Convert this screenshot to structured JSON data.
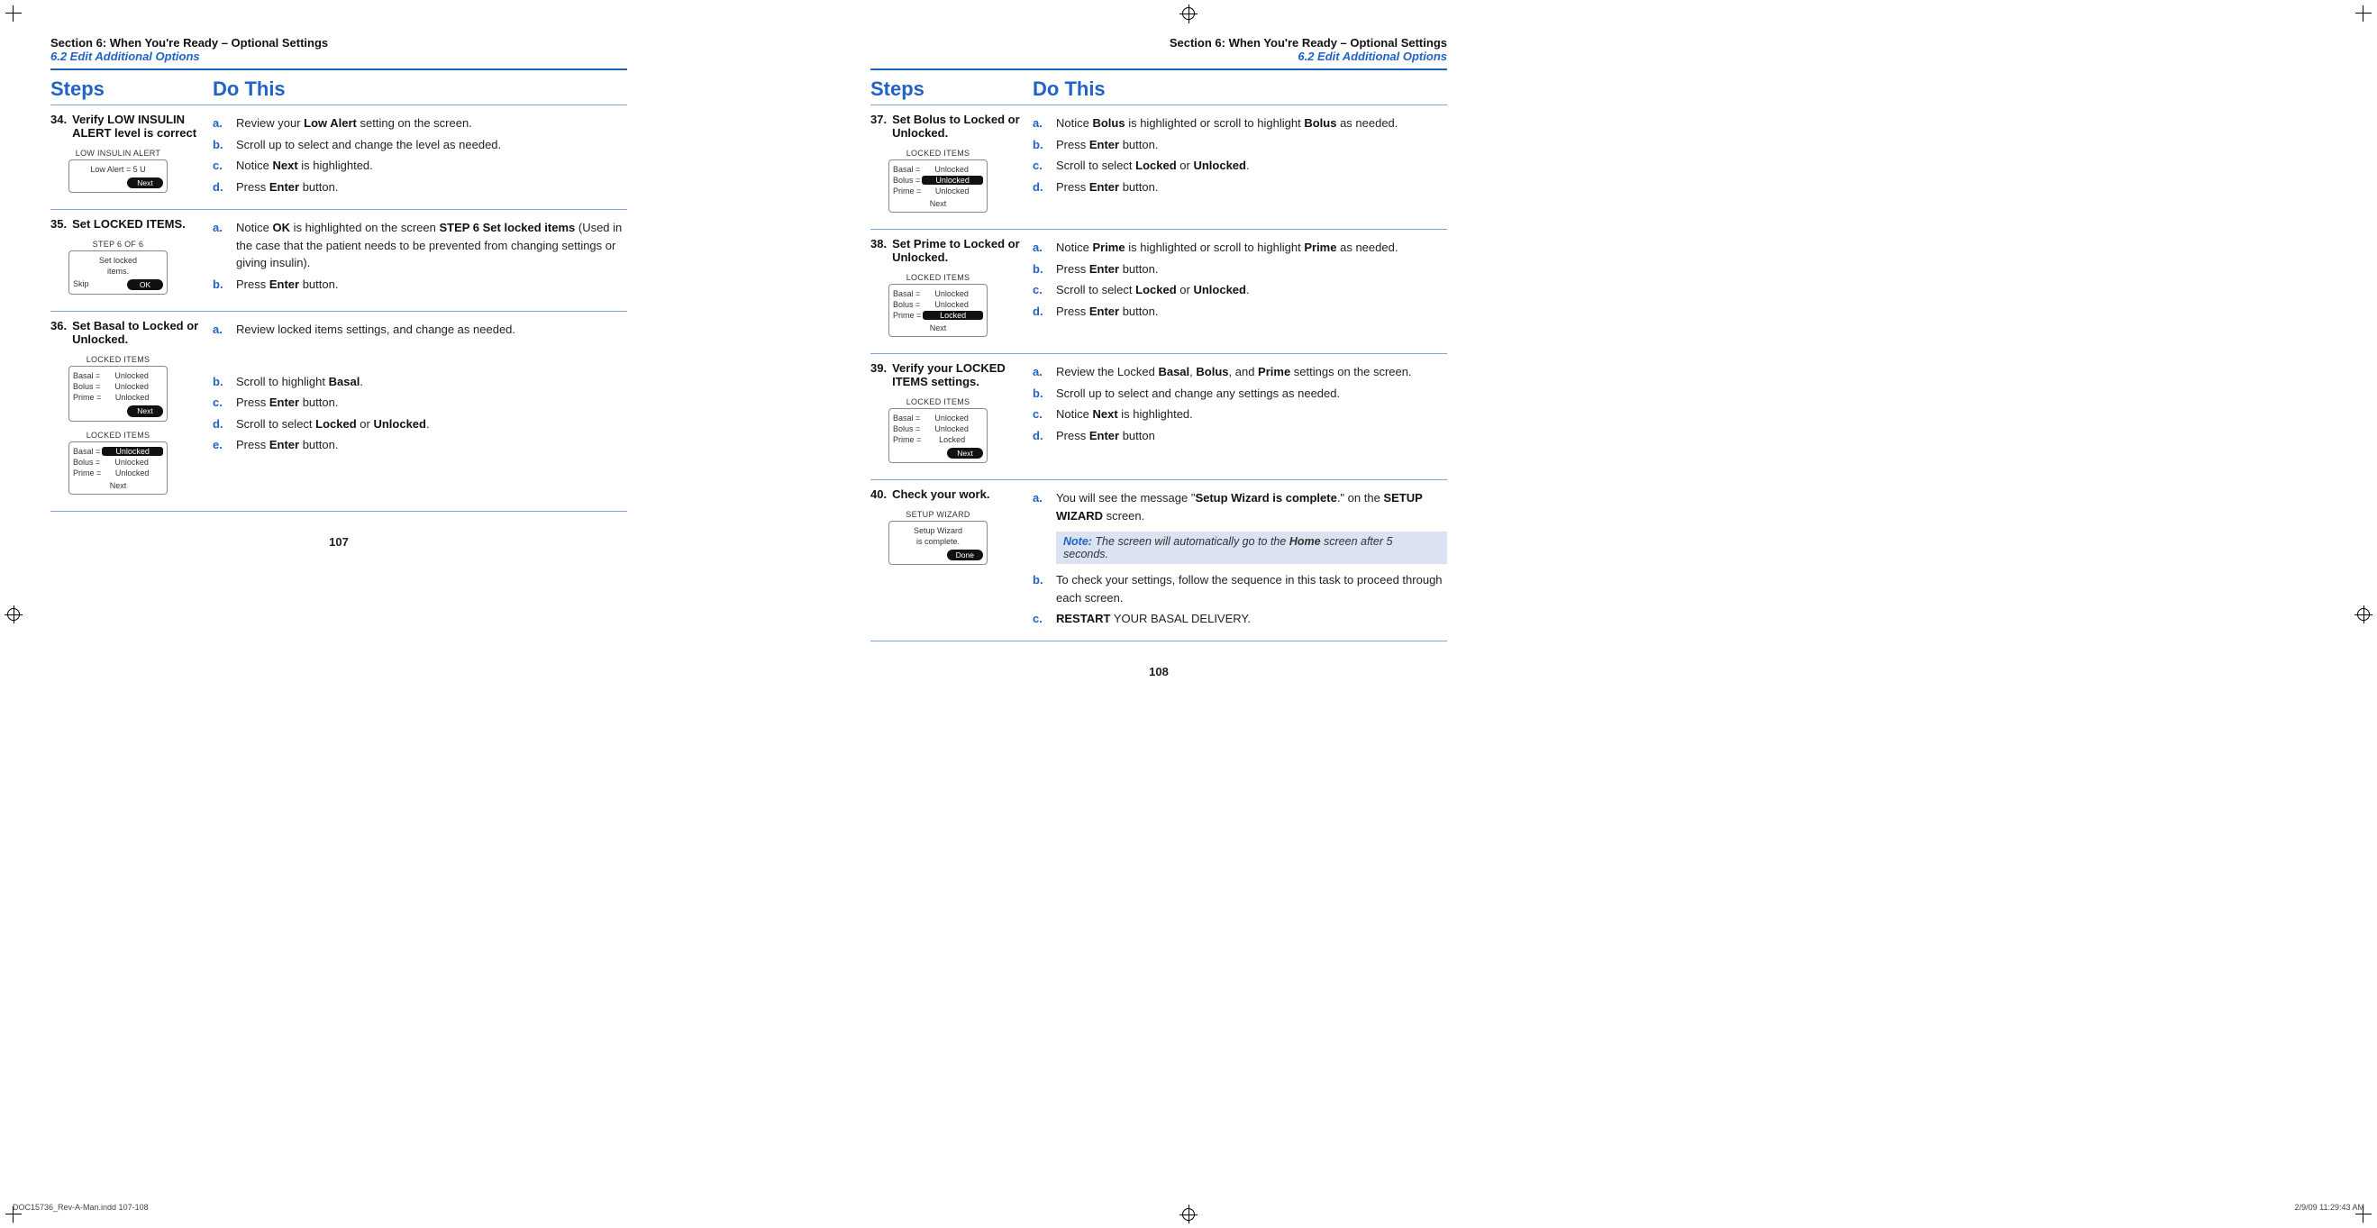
{
  "header": {
    "section_title": "Section 6: When You're Ready – Optional Settings",
    "section_sub": "6.2 Edit Additional Options"
  },
  "columns": {
    "steps": "Steps",
    "dothis": "Do This"
  },
  "left_page": {
    "steps": [
      {
        "num": "34.",
        "title_html": "Verify <b>LOW INSULIN ALERT level is correct</b>",
        "device": {
          "title": "LOW INSULIN ALERT",
          "lines": [
            "Low Alert = 5 U"
          ],
          "buttons": [
            {
              "label": "Next",
              "style": "solid",
              "align": "right"
            }
          ]
        },
        "instr": [
          {
            "l": "a.",
            "html": "Review your <b>Low Alert</b> setting on the screen."
          },
          {
            "l": "b.",
            "html": "Scroll up to select and change the level as needed."
          },
          {
            "l": "c.",
            "html": "Notice <b>Next</b> is highlighted."
          },
          {
            "l": "d.",
            "html": "Press <b>Enter</b> button."
          }
        ]
      },
      {
        "num": "35.",
        "title_html": "<b>Set LOCKED ITEMS.</b>",
        "device": {
          "title": "STEP 6 OF 6",
          "lines": [
            "Set locked",
            "items."
          ],
          "buttons": [
            {
              "label": "Skip",
              "style": "text",
              "align": "left"
            },
            {
              "label": "OK",
              "style": "solid",
              "align": "right"
            }
          ]
        },
        "instr": [
          {
            "l": "a.",
            "html": "Notice <b>OK</b> is highlighted on the screen <b>STEP 6 Set locked items</b> (Used in the case that the patient needs to be prevented from changing settings or giving insulin)."
          },
          {
            "l": "b.",
            "html": "Press <b>Enter</b> button."
          }
        ]
      },
      {
        "num": "36.",
        "title_html": "<b>Set Basal to Locked or Unlocked.</b>",
        "devices": [
          {
            "title": "LOCKED ITEMS",
            "rows": [
              {
                "label": "Basal =",
                "val": "Unlocked"
              },
              {
                "label": "Bolus =",
                "val": "Unlocked"
              },
              {
                "label": "Prime =",
                "val": "Unlocked"
              }
            ],
            "buttons": [
              {
                "label": "Next",
                "style": "solid",
                "align": "right"
              }
            ]
          },
          {
            "title": "LOCKED ITEMS",
            "rows": [
              {
                "label": "Basal =",
                "val": "Unlocked",
                "boxed": true
              },
              {
                "label": "Bolus =",
                "val": "Unlocked"
              },
              {
                "label": "Prime =",
                "val": "Unlocked"
              }
            ],
            "buttons": [
              {
                "label": "Next",
                "style": "text",
                "align": "center"
              }
            ]
          }
        ],
        "instr": [
          {
            "l": "a.",
            "html": "Review locked items settings, and change as needed.",
            "gap_after": true
          },
          {
            "l": "b.",
            "html": "Scroll to highlight <b>Basal</b>."
          },
          {
            "l": "c.",
            "html": "Press <b>Enter</b> button."
          },
          {
            "l": "d.",
            "html": "Scroll to select <b>Locked</b> or <b>Unlocked</b>."
          },
          {
            "l": "e.",
            "html": "Press <b>Enter</b> button."
          }
        ]
      }
    ],
    "page_number": "107"
  },
  "right_page": {
    "steps": [
      {
        "num": "37.",
        "title_html": "<b>Set Bolus to Locked or Unlocked.</b>",
        "device": {
          "title": "LOCKED ITEMS",
          "rows": [
            {
              "label": "Basal =",
              "val": "Unlocked"
            },
            {
              "label": "Bolus =",
              "val": "Unlocked",
              "boxed": true
            },
            {
              "label": "Prime =",
              "val": "Unlocked"
            }
          ],
          "buttons": [
            {
              "label": "Next",
              "style": "text",
              "align": "center"
            }
          ]
        },
        "instr": [
          {
            "l": "a.",
            "html": "Notice <b>Bolus</b> is highlighted or scroll to highlight <b>Bolus</b> as needed."
          },
          {
            "l": "b.",
            "html": "Press <b>Enter</b> button."
          },
          {
            "l": "c.",
            "html": "Scroll to select <b>Locked</b> or <b>Unlocked</b>."
          },
          {
            "l": "d.",
            "html": "Press <b>Enter</b> button."
          }
        ]
      },
      {
        "num": "38.",
        "title_html": "<b>Set Prime to Locked or Unlocked.</b>",
        "device": {
          "title": "LOCKED ITEMS",
          "rows": [
            {
              "label": "Basal =",
              "val": "Unlocked"
            },
            {
              "label": "Bolus =",
              "val": "Unlocked"
            },
            {
              "label": "Prime =",
              "val": "Locked",
              "boxed": true
            }
          ],
          "buttons": [
            {
              "label": "Next",
              "style": "text",
              "align": "center"
            }
          ]
        },
        "instr": [
          {
            "l": "a.",
            "html": "Notice <b>Prime</b> is highlighted or scroll to highlight <b>Prime</b> as needed."
          },
          {
            "l": "b.",
            "html": "Press <b>Enter</b> button."
          },
          {
            "l": "c.",
            "html": "Scroll to select <b>Locked</b> or <b>Unlocked</b>."
          },
          {
            "l": "d.",
            "html": "Press <b>Enter</b> button."
          }
        ]
      },
      {
        "num": "39.",
        "title_html": "<b>Verify your LOCKED ITEMS settings.</b>",
        "device": {
          "title": "LOCKED ITEMS",
          "rows": [
            {
              "label": "Basal =",
              "val": "Unlocked"
            },
            {
              "label": "Bolus =",
              "val": "Unlocked"
            },
            {
              "label": "Prime =",
              "val": "Locked"
            }
          ],
          "buttons": [
            {
              "label": "Next",
              "style": "solid",
              "align": "right"
            }
          ]
        },
        "instr": [
          {
            "l": "a.",
            "html": "Review the Locked <b>Basal</b>, <b>Bolus</b>, and <b>Prime</b> settings on the screen."
          },
          {
            "l": "b.",
            "html": "Scroll up to select and change any settings as needed."
          },
          {
            "l": "c.",
            "html": "Notice <b>Next</b> is highlighted."
          },
          {
            "l": "d.",
            "html": "Press <b>Enter</b> button"
          }
        ]
      },
      {
        "num": "40.",
        "title_html": "<b>Check your work.</b>",
        "device": {
          "title": "SETUP WIZARD",
          "lines": [
            "Setup Wizard",
            "is complete."
          ],
          "buttons": [
            {
              "label": "Done",
              "style": "solid",
              "align": "right"
            }
          ]
        },
        "instr": [
          {
            "l": "a.",
            "html": "You will see the message \"<b>Setup Wizard is complete</b>.\" on the <b>SETUP WIZARD</b> screen."
          },
          {
            "note": true,
            "html": "<b>Note:</b> The screen will automatically go to the <span class='home'>Home</span> screen after 5 seconds."
          },
          {
            "l": "b.",
            "html": "To check your settings, follow the sequence in this task to proceed through each screen."
          },
          {
            "l": "c.",
            "html": "<b>RESTART</b> YOUR BASAL DELIVERY."
          }
        ]
      }
    ],
    "page_number": "108"
  },
  "footer": {
    "left": "DOC15736_Rev-A-Man.indd   107-108",
    "right": "2/9/09   11:29:43 AM"
  }
}
